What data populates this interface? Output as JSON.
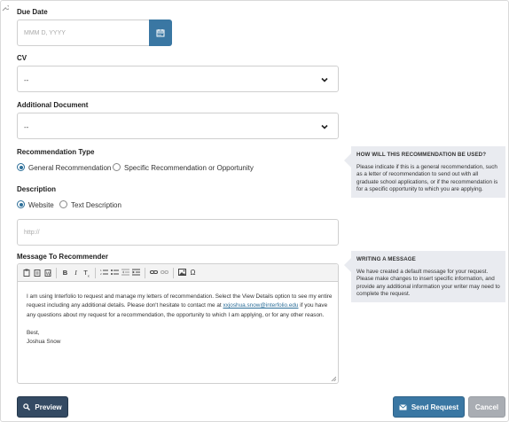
{
  "form": {
    "due_date": {
      "label": "Due Date",
      "placeholder": "MMM D, YYYY"
    },
    "cv": {
      "label": "CV",
      "value": "--"
    },
    "additional_document": {
      "label": "Additional Document",
      "value": "--"
    },
    "recommendation_type": {
      "label": "Recommendation Type",
      "options": [
        "General Recommendation",
        "Specific Recommendation or Opportunity"
      ],
      "selected": "General Recommendation"
    },
    "description": {
      "label": "Description",
      "options": [
        "Website",
        "Text Description"
      ],
      "selected": "Website",
      "url_placeholder": "http://"
    },
    "message": {
      "label": "Message To Recommender",
      "body_pre_link": "I am using Interfolio to request and manage my letters of recommendation. Select the View Details option to see my entire request including any additional details. Please don't hesitate to contact me at ",
      "body_link": "xxjoshua.snow@interfolio.edu",
      "body_post_link": " if you have any questions about my request for a recommendation, the opportunity to which I am applying, or for any other reason.",
      "signoff": "Best,",
      "signature": "Joshua Snow"
    }
  },
  "tips": {
    "recommendation_use": {
      "title": "HOW WILL THIS RECOMMENDATION BE USED?",
      "text": "Please indicate if this is a general recommendation, such as a letter of recommendation to send out with all graduate school applications, or if the recommendation is for a specific opportunity to which you are applying."
    },
    "writing_message": {
      "title": "WRITING A MESSAGE",
      "text": "We have created a default message for your request. Please make changes to insert specific information, and provide any additional information your writer may need to complete the request."
    }
  },
  "buttons": {
    "preview": "Preview",
    "send_request": "Send Request",
    "cancel": "Cancel"
  },
  "colors": {
    "primary": "#3a77a3",
    "dark": "#344a63",
    "disabled": "#a9adb3",
    "tip_bg": "#e9ebf0"
  }
}
